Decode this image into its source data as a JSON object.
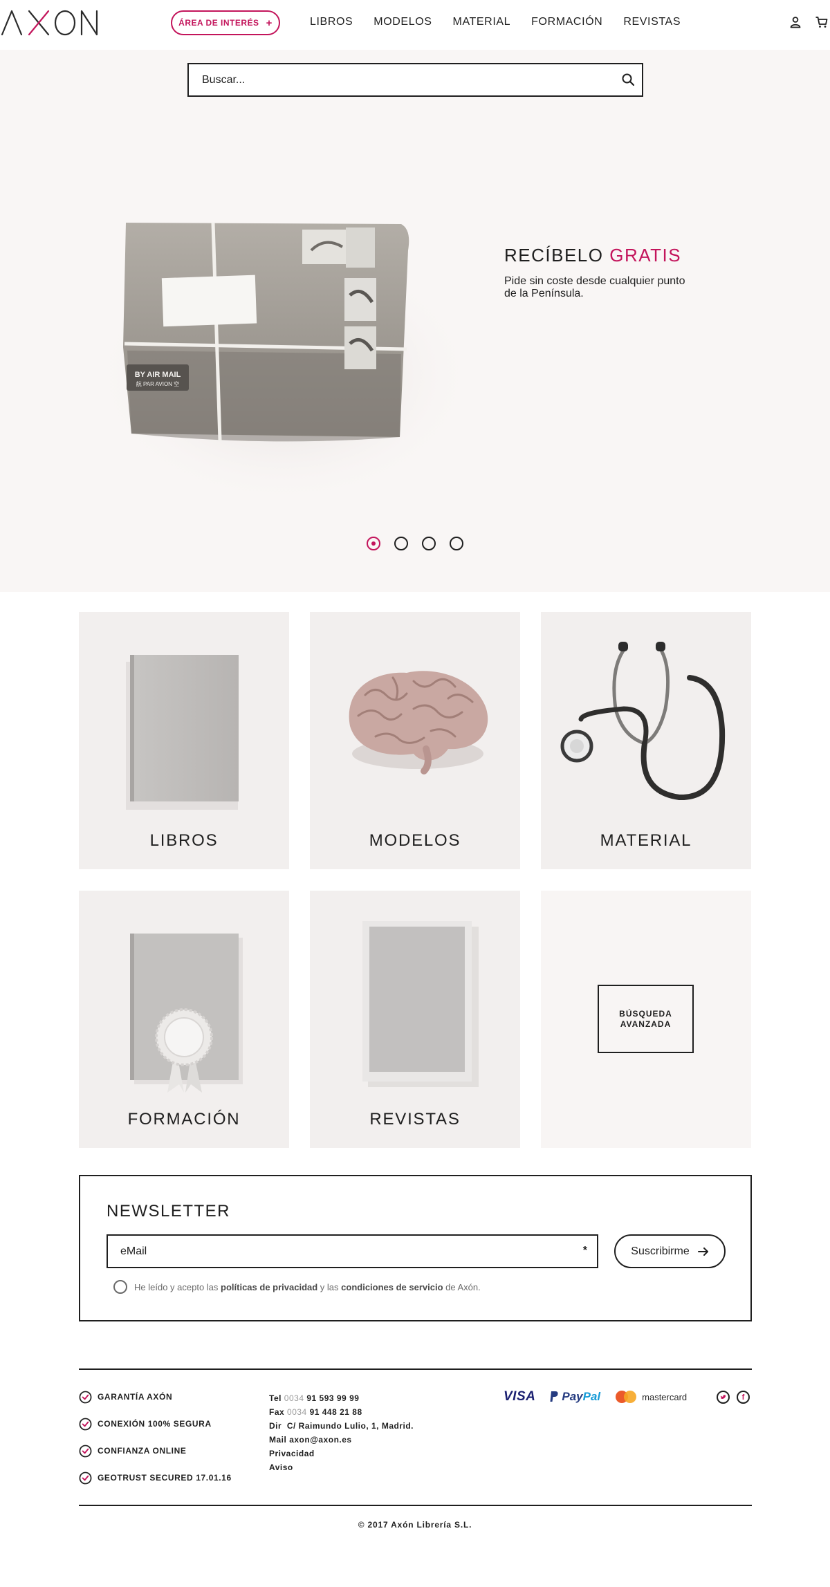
{
  "header": {
    "logo_text": "AXON",
    "area_button": "ÁREA DE INTERÉS",
    "area_button_icon": "plus-icon",
    "nav": [
      "LIBROS",
      "MODELOS",
      "MATERIAL",
      "FORMACIÓN",
      "REVISTAS"
    ],
    "icons": [
      "user-icon",
      "cart-icon"
    ]
  },
  "search": {
    "placeholder": "Buscar...",
    "icon": "search-icon"
  },
  "hero": {
    "title_plain": "RECÍBELO ",
    "title_accent": "GRATIS",
    "text": "Pide sin coste desde cualquier punto de la Península.",
    "parcel_label_1": "BY AIR MAIL",
    "parcel_label_2": "航 PAR AVION 空",
    "slides_total": 4,
    "active_slide": 1
  },
  "categories": [
    {
      "label": "LIBROS",
      "image": "book"
    },
    {
      "label": "MODELOS",
      "image": "brain"
    },
    {
      "label": "MATERIAL",
      "image": "stethoscope"
    },
    {
      "label": "FORMACIÓN",
      "image": "certificate-book"
    },
    {
      "label": "REVISTAS",
      "image": "magazine"
    }
  ],
  "advanced_search": {
    "line1": "BÚSQUEDA",
    "line2": "AVANZADA"
  },
  "newsletter": {
    "title": "NEWSLETTER",
    "email_placeholder": "eMail",
    "required_mark": "*",
    "subscribe_label": "Suscribirme",
    "consent_1": "He leído y acepto las ",
    "consent_link_1": "políticas de privacidad",
    "consent_2": " y las ",
    "consent_link_2": "condiciones de servicio",
    "consent_3": " de Axón."
  },
  "footer": {
    "guarantees": [
      "GARANTÍA AXÓN",
      "CONEXIÓN 100% SEGURA",
      "CONFIANZA ONLINE",
      "GEOTRUST SECURED 17.01.16"
    ],
    "tel_label": "Tel",
    "tel_prefix": "0034",
    "tel_number": "91 593 99 99",
    "fax_label": "Fax",
    "fax_prefix": "0034",
    "fax_number": "91 448 21 88",
    "dir_label": "Dir",
    "dir_value": "C/ Raimundo Lulio, 1, Madrid.",
    "mail_label": "Mail",
    "mail_value": "axon@axon.es",
    "privacy": "Privacidad",
    "notice": "Aviso",
    "payments": {
      "visa": "VISA",
      "paypal_1": "Pay",
      "paypal_2": "Pal",
      "mastercard": "mastercard"
    },
    "social": [
      "twitter-icon",
      "facebook-icon"
    ],
    "copyright": "© 2017 Axón Librería S.L."
  },
  "colors": {
    "accent": "#c3145b",
    "text": "#1f1f1f",
    "hero_bg": "#f9f6f5",
    "card_bg": "#f2efee"
  }
}
